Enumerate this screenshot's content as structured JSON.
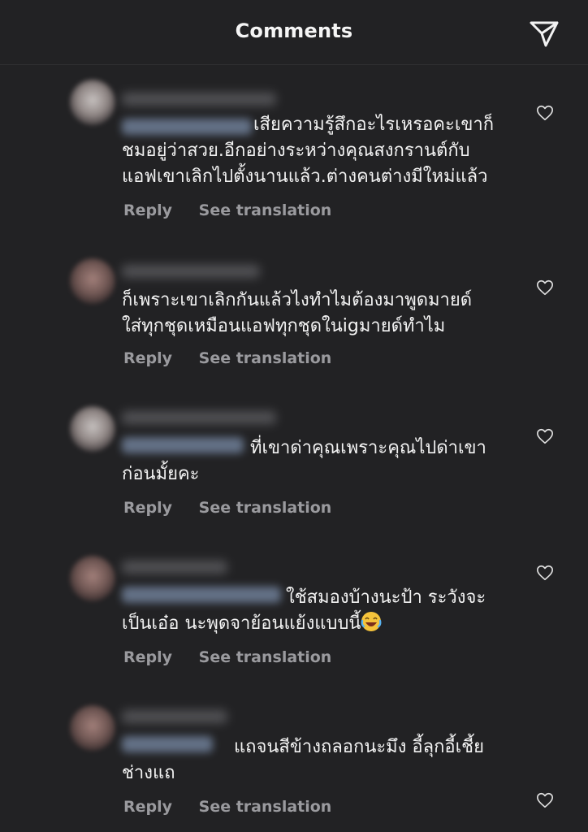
{
  "header": {
    "title": "Comments",
    "send_icon": "paper-plane-icon"
  },
  "comments": [
    {
      "text": "เสียความรู้สึกอะไรเหรอคะเขาก็ชมอยู่ว่าสวย.อีกอย่างระหว่างคุณสงกรานต์กับแอฟเขาเลิกไปตั้งนานแล้ว.ต่างคนต่างมีใหม่แล้ว",
      "line1": "เสียความรู้สึกอะไรเหรอคะเขาก็",
      "line2": "ชมอยู่ว่าสวย.อีกอย่างระหว่างคุณสงกรานต์กับ",
      "line3": "แอฟเขาเลิกไปตั้งนานแล้ว.ต่างคนต่างมีใหม่แล้ว",
      "reply": "Reply",
      "translate": "See translation"
    },
    {
      "line1": "ก็เพราะเขาเลิกกันแล้วไงทำไมต้องมาพูดมายด์",
      "line2": "ใส่ทุกชุดเหมือนแอฟทุกชุดในigมายด์ทำไม",
      "reply": "Reply",
      "translate": "See translation"
    },
    {
      "line1": "ที่เขาด่าคุณเพราะคุณไปด่าเขา",
      "line2": "ก่อนมั้ยคะ",
      "reply": "Reply",
      "translate": "See translation"
    },
    {
      "line1": "ใช้สมองบ้างนะป้า ระวังจะ",
      "line2": "เป็นเอ๋อ นะพุดจาย้อนแย้งแบบนี้",
      "emoji": "😂",
      "reply": "Reply",
      "translate": "See translation"
    },
    {
      "line1": "แถจนสีข้างถลอกนะมึง อี้ลุกอี้เชี้ย",
      "line2": "ช่างแถ",
      "reply": "Reply",
      "translate": "See translation"
    }
  ],
  "colors": {
    "background": "#222224",
    "text": "#f2f2f2",
    "muted": "#9a9a9e"
  }
}
